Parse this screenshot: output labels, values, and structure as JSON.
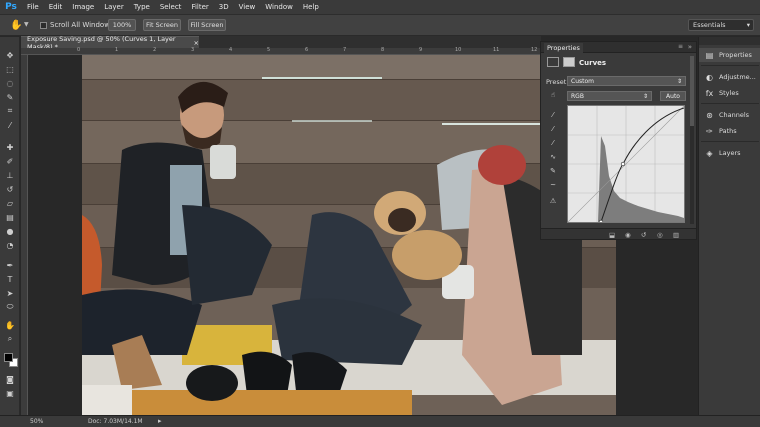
{
  "app": {
    "logo": "Ps"
  },
  "menu": [
    "File",
    "Edit",
    "Image",
    "Layer",
    "Type",
    "Select",
    "Filter",
    "3D",
    "View",
    "Window",
    "Help"
  ],
  "options_bar": {
    "scroll_all_label": "Scroll All Windows",
    "zoom_btn": "100%",
    "fit_btn": "Fit Screen",
    "fill_btn": "Fill Screen",
    "workspace": "Essentials"
  },
  "document": {
    "tab_title": "Exposure Saving.psd @ 50% (Curves 1, Layer Mask/8) *",
    "tab_close": "×",
    "ruler_labels": [
      "0",
      "1",
      "2",
      "3",
      "4",
      "5",
      "6",
      "7",
      "8",
      "9",
      "10",
      "11",
      "12"
    ]
  },
  "properties": {
    "tab": "Properties",
    "title": "Curves",
    "preset_label": "Preset:",
    "preset_value": "Custom",
    "channel_value": "RGB",
    "auto_label": "Auto"
  },
  "dock": {
    "items": [
      {
        "label": "Properties",
        "icon": "properties-icon",
        "active": true
      },
      {
        "label": "Adjustme...",
        "icon": "adjustments-icon",
        "active": false
      },
      {
        "label": "Styles",
        "icon": "styles-icon",
        "active": false
      },
      {
        "label": "Channels",
        "icon": "channels-icon",
        "active": false
      },
      {
        "label": "Paths",
        "icon": "paths-icon",
        "active": false
      },
      {
        "label": "Layers",
        "icon": "layers-icon",
        "active": false
      }
    ]
  },
  "status": {
    "zoom": "50%",
    "doc": "Doc: 7.03M/14.1M"
  },
  "colors": {
    "ps_blue": "#31a8ff",
    "panel_bg": "#3a3a3a",
    "canvas_bg": "#282828"
  }
}
